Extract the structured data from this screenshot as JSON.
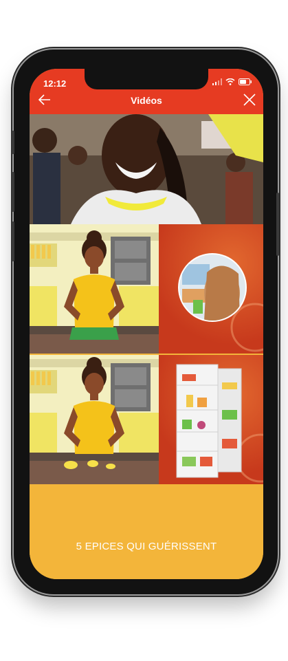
{
  "status_bar": {
    "time": "12:12"
  },
  "header": {
    "title": "Vidéos",
    "back_icon": "arrow-left-icon",
    "close_icon": "close-icon"
  },
  "videos": [
    {
      "name": "hero-video",
      "type": "photo"
    },
    {
      "name": "kitchen-video-1",
      "type": "illustration"
    },
    {
      "name": "hair-video",
      "type": "illustration"
    },
    {
      "name": "kitchen-video-2",
      "type": "illustration"
    },
    {
      "name": "fridge-video",
      "type": "illustration"
    }
  ],
  "caption": "5 EPICES QUI GUÉRISSENT",
  "colors": {
    "app_bar": "#e63b22",
    "background": "#f3b53a",
    "accent_orange": "#c7391c"
  }
}
